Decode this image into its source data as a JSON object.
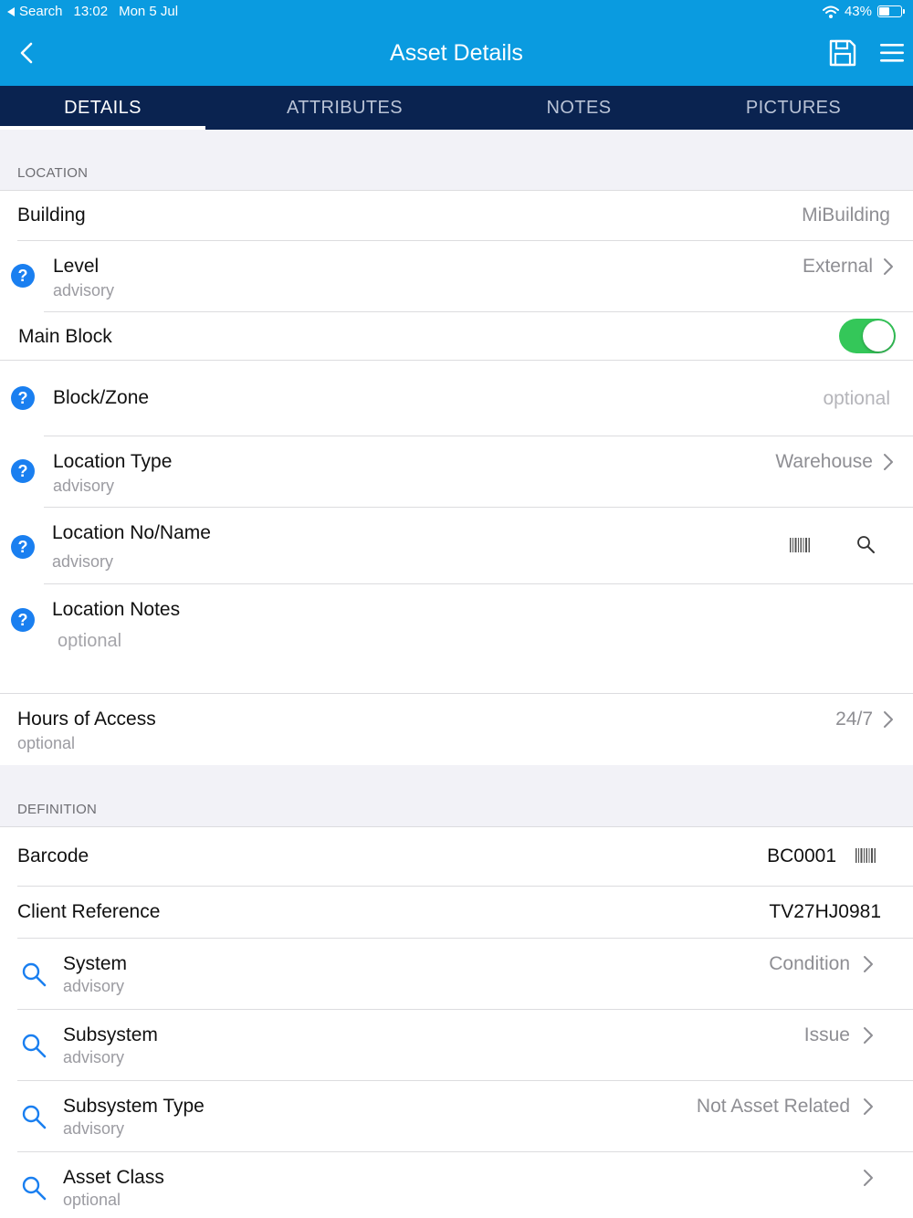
{
  "status_bar": {
    "back_app": "Search",
    "time": "13:02",
    "date": "Mon 5 Jul",
    "battery": "43%"
  },
  "nav": {
    "title": "Asset Details"
  },
  "tabs": [
    {
      "label": "DETAILS",
      "active": true
    },
    {
      "label": "ATTRIBUTES",
      "active": false
    },
    {
      "label": "NOTES",
      "active": false
    },
    {
      "label": "PICTURES",
      "active": false
    }
  ],
  "location": {
    "header": "LOCATION",
    "building": {
      "label": "Building",
      "value": "MiBuilding"
    },
    "level": {
      "label": "Level",
      "sub": "advisory",
      "value": "External"
    },
    "main_block": {
      "label": "Main Block",
      "on": true
    },
    "block_zone": {
      "label": "Block/Zone",
      "placeholder": "optional"
    },
    "location_type": {
      "label": "Location Type",
      "sub": "advisory",
      "value": "Warehouse"
    },
    "location_no": {
      "label": "Location No/Name",
      "sub": "advisory"
    },
    "location_notes": {
      "label": "Location Notes",
      "placeholder": "optional"
    },
    "hours": {
      "label": "Hours of Access",
      "sub": "optional",
      "value": "24/7"
    }
  },
  "definition": {
    "header": "DEFINITION",
    "barcode": {
      "label": "Barcode",
      "value": "BC0001"
    },
    "client_ref": {
      "label": "Client Reference",
      "value": "TV27HJ0981"
    },
    "system": {
      "label": "System",
      "sub": "advisory",
      "value": "Condition"
    },
    "subsystem": {
      "label": "Subsystem",
      "sub": "advisory",
      "value": "Issue"
    },
    "subsystem_type": {
      "label": "Subsystem Type",
      "sub": "advisory",
      "value": "Not Asset Related"
    },
    "asset_class": {
      "label": "Asset Class",
      "sub": "optional",
      "value": ""
    }
  },
  "colors": {
    "nav_blue": "#0a9be0",
    "tab_navy": "#0a2350",
    "help_blue": "#1a7ff0",
    "toggle_green": "#34c759"
  }
}
